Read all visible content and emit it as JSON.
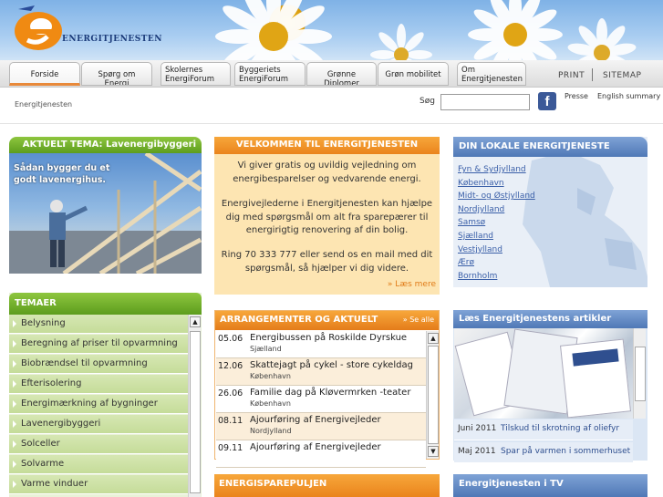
{
  "header": {
    "logo_letter": "e",
    "logo_text": "ENERGITJENESTEN"
  },
  "nav": {
    "tabs": [
      {
        "label": "Forside",
        "active": true
      },
      {
        "label": "Spørg om Energi"
      },
      {
        "label": "Skolernes EnergiForum"
      },
      {
        "label": "Byggeriets EnergiForum"
      },
      {
        "label": "Grønne Diplomer"
      },
      {
        "label": "Grøn mobilitet"
      },
      {
        "label": "Om Energitjenesten"
      }
    ],
    "print_label": "PRINT",
    "sitemap_label": "SITEMAP"
  },
  "subbar": {
    "breadcrumb": "Energitjenesten",
    "search_label": "Søg",
    "search_value": "",
    "facebook_glyph": "f",
    "presse_label": "Presse",
    "english_label": "English summary"
  },
  "tema": {
    "title": "AKTUELT TEMA: Lavenergibyggeri",
    "caption": "Sådan bygger du et godt lavenergihus."
  },
  "temaer": {
    "title": "TEMAER",
    "items": [
      "Belysning",
      "Beregning af priser til opvarmning",
      "Biobrændsel til opvarmning",
      "Efterisolering",
      "Energimærkning af bygninger",
      "Lavenergibyggeri",
      "Solceller",
      "Solvarme",
      "Varme vinduer"
    ]
  },
  "welcome": {
    "title": "VELKOMMEN TIL ENERGITJENESTEN",
    "paragraphs": [
      "Vi giver gratis og uvildig vejledning om energibesparelser og vedvarende energi.",
      "Energivejlederne i Energitjenesten kan hjælpe dig med spørgsmål om alt fra sparepærer til energirigtig renovering af din bolig.",
      "Ring 70 333 777 eller send os en mail med dit spørgsmål, så hjælper vi dig videre."
    ],
    "more": "» Læs mere"
  },
  "events": {
    "title": "ARRANGEMENTER OG AKTUELT",
    "see_all": "» Se alle",
    "items": [
      {
        "date": "05.06",
        "title": "Energibussen på Roskilde Dyrskue",
        "place": "Sjælland"
      },
      {
        "date": "12.06",
        "title": "Skattejagt på cykel - store cykeldag",
        "place": "København"
      },
      {
        "date": "26.06",
        "title": "Familie dag på Kløvermrken -teater",
        "place": "København"
      },
      {
        "date": "08.11",
        "title": "Ajourføring af Energivejleder",
        "place": "Nordjylland"
      },
      {
        "date": "09.11",
        "title": "Ajourføring af Energivejleder",
        "place": ""
      }
    ]
  },
  "pulje": {
    "title": "ENERGISPAREPULJEN"
  },
  "lokal": {
    "title": "DIN LOKALE ENERGITJENESTE",
    "regions": [
      "Fyn & Sydjylland",
      "København",
      "Midt- og Østjylland",
      "Nordjylland",
      "Samsø",
      "Sjælland",
      "Vestjylland",
      "Ærø",
      "Bornholm"
    ]
  },
  "artikler": {
    "title": "Læs Energitjenestens artikler",
    "items": [
      {
        "date": "Juni 2011",
        "title": "Tilskud til skrotning af oliefyr"
      },
      {
        "date": "Maj 2011",
        "title": "Spar på varmen i sommerhuset"
      }
    ]
  },
  "tv": {
    "title": "Energitjenesten i TV"
  },
  "colors": {
    "green_header": "#5d9d1d",
    "orange_header": "#ea841c",
    "blue_header": "#4f78b6",
    "welcome_bg": "#fde5b2"
  }
}
